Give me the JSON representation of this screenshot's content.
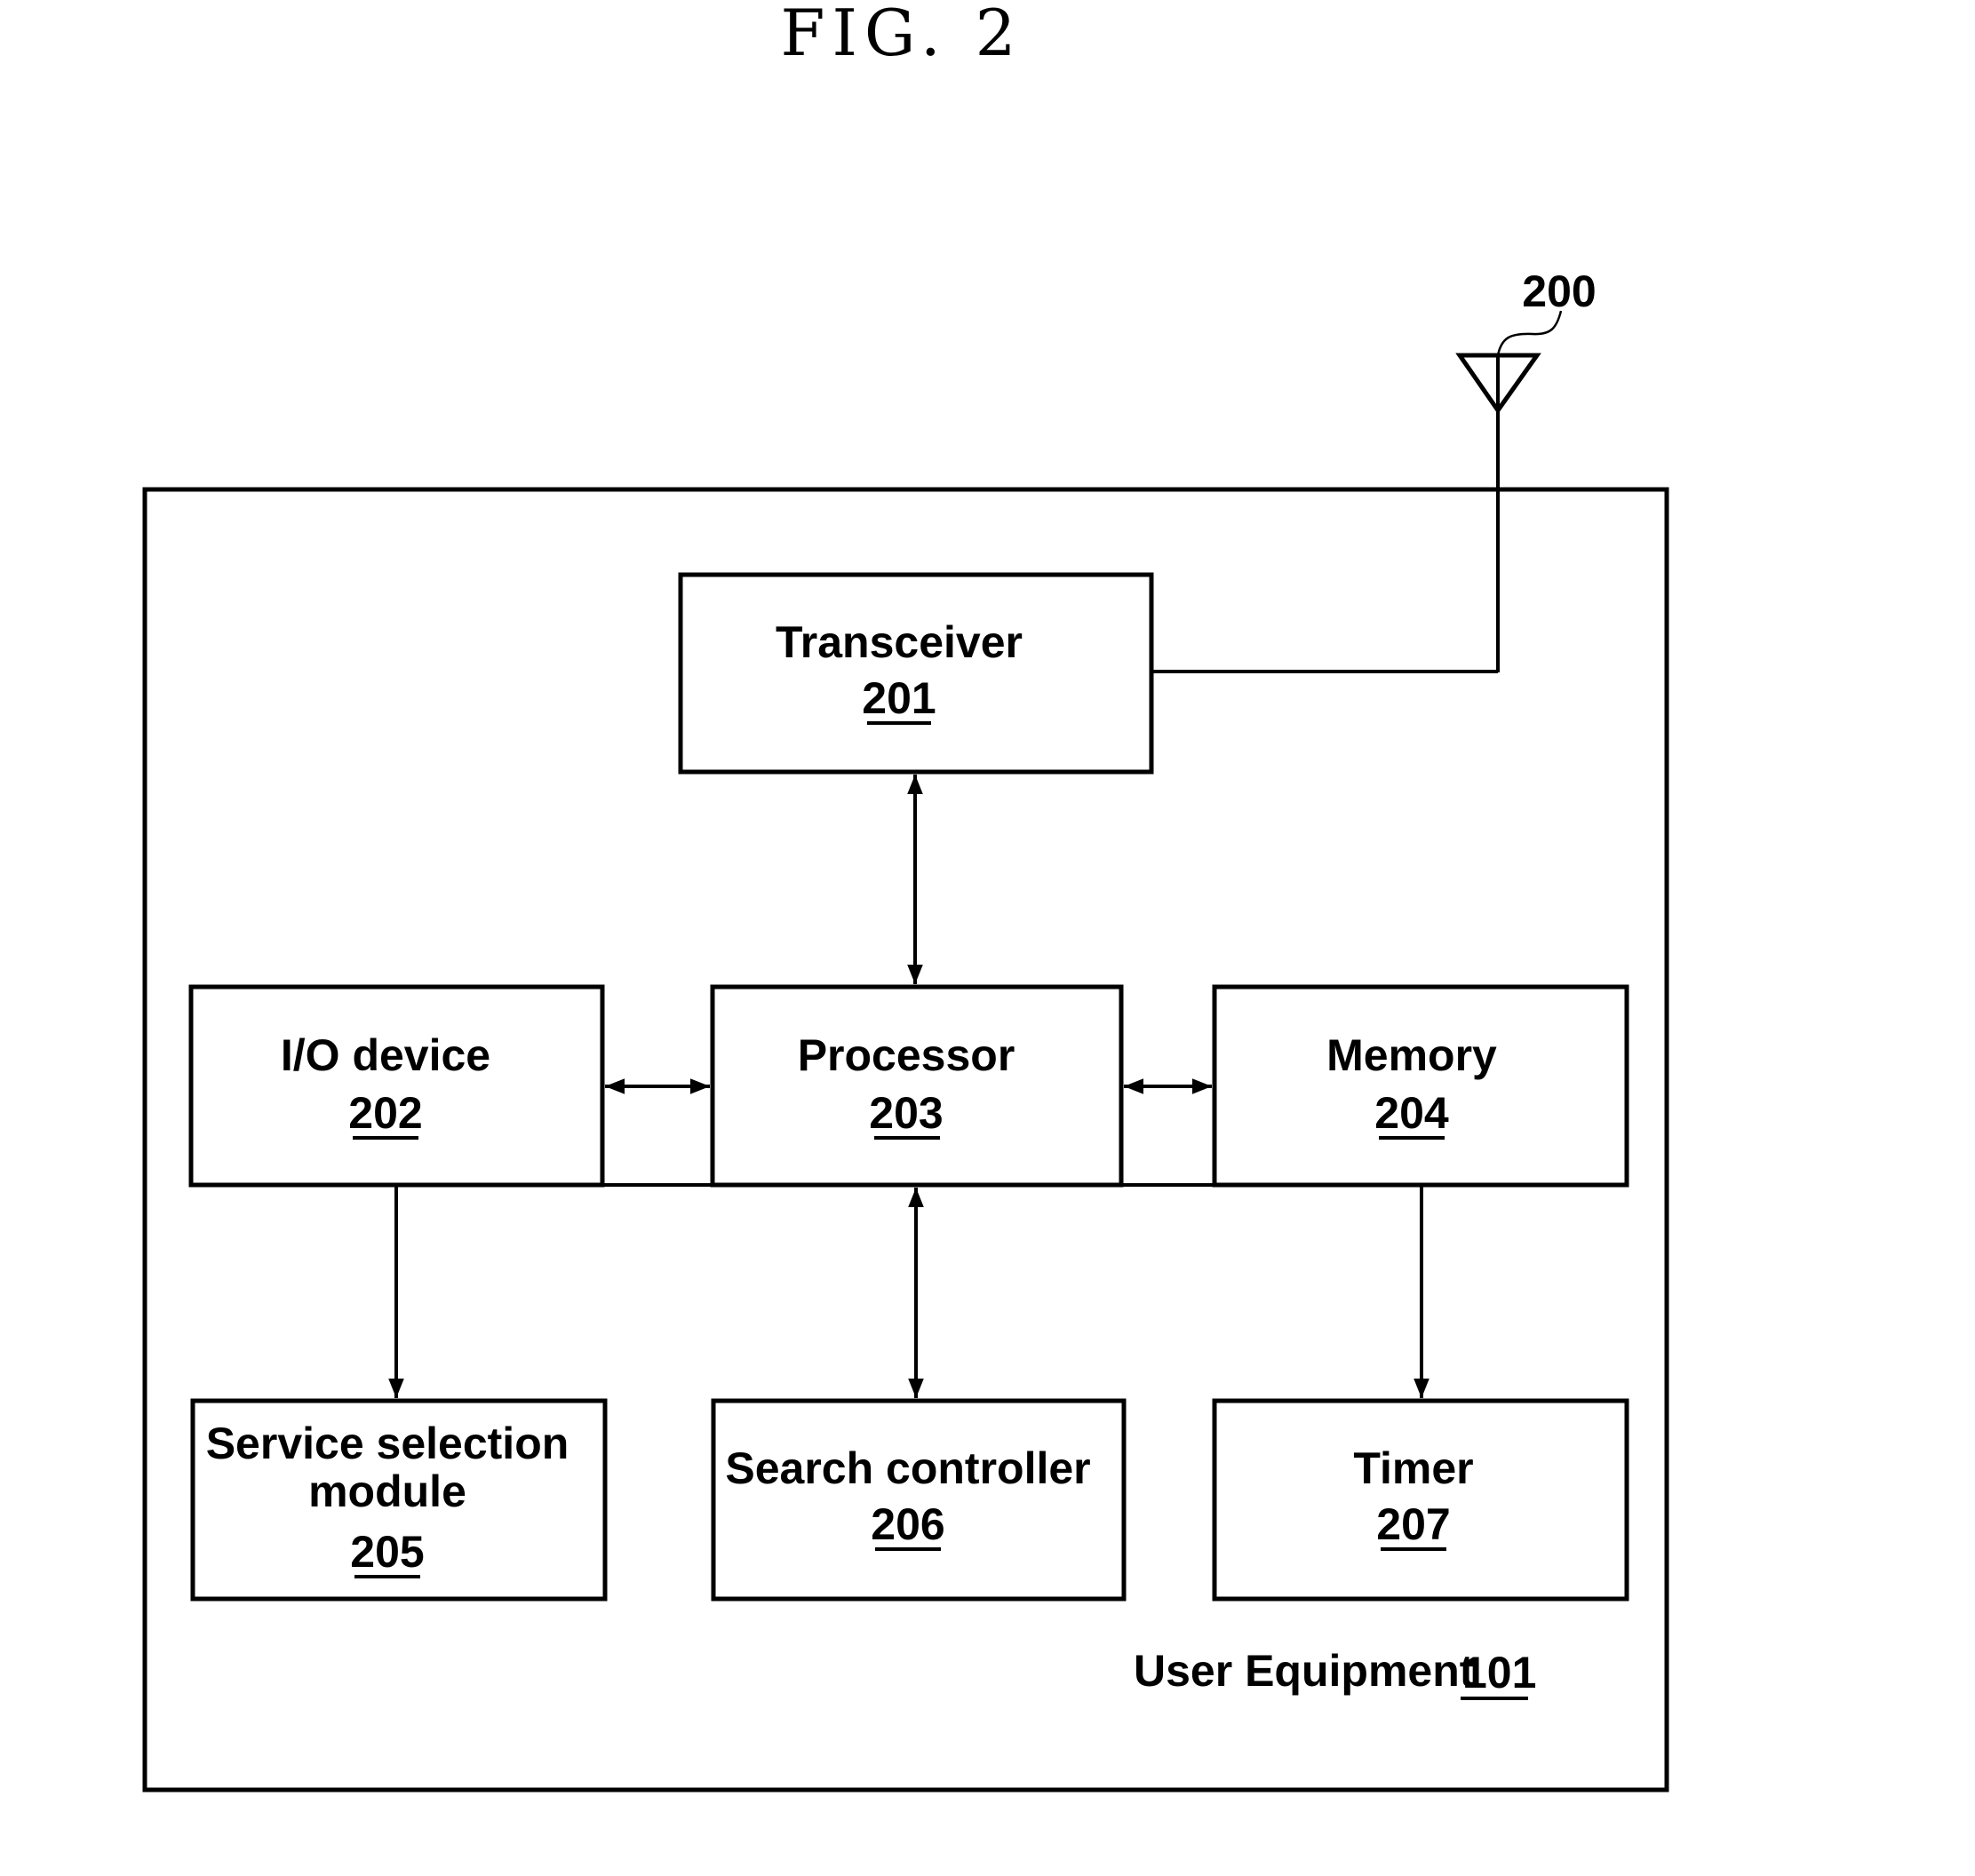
{
  "figure": {
    "title": "FIG. 2",
    "antenna_ref": "200",
    "container": {
      "label": "User Equipment",
      "ref": "101"
    },
    "blocks": [
      {
        "id": "transceiver",
        "lines": [
          "Transceiver"
        ],
        "ref": "201"
      },
      {
        "id": "io-device",
        "lines": [
          "I/O device"
        ],
        "ref": "202"
      },
      {
        "id": "processor",
        "lines": [
          "Processor"
        ],
        "ref": "203"
      },
      {
        "id": "memory",
        "lines": [
          "Memory"
        ],
        "ref": "204"
      },
      {
        "id": "service-selection-module",
        "lines": [
          "Service selection",
          "module"
        ],
        "ref": "205"
      },
      {
        "id": "search-controller",
        "lines": [
          "Search controller"
        ],
        "ref": "206"
      },
      {
        "id": "timer",
        "lines": [
          "Timer"
        ],
        "ref": "207"
      }
    ],
    "connections": [
      {
        "from": "antenna",
        "to": "transceiver",
        "type": "line"
      },
      {
        "from": "transceiver",
        "to": "processor",
        "type": "bidirectional"
      },
      {
        "from": "io-device",
        "to": "processor",
        "type": "bidirectional"
      },
      {
        "from": "processor",
        "to": "memory",
        "type": "bidirectional"
      },
      {
        "from": "io-device",
        "to": "service-selection-module",
        "type": "unidirectional"
      },
      {
        "from": "processor",
        "to": "search-controller",
        "type": "bidirectional"
      },
      {
        "from": "memory",
        "to": "timer",
        "type": "unidirectional"
      }
    ]
  }
}
